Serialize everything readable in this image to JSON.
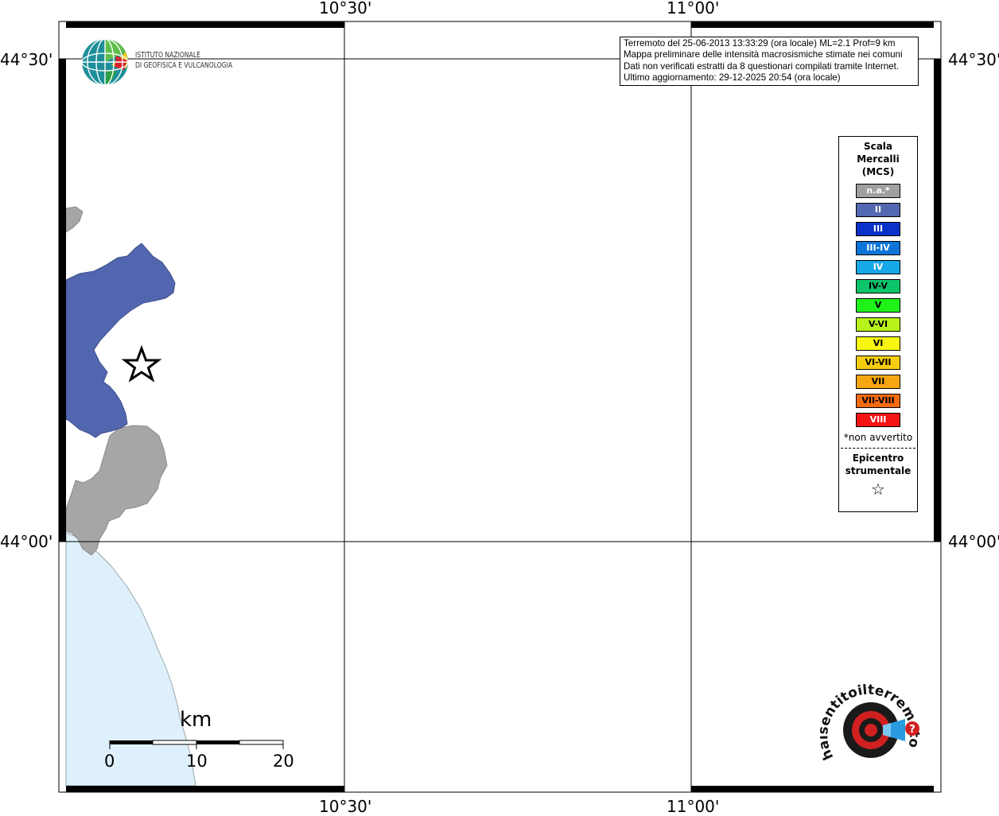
{
  "map": {
    "lon_labels": [
      "10°30'",
      "11°00'"
    ],
    "lat_labels": [
      "44°30'",
      "44°00'"
    ]
  },
  "info": {
    "line1": "Terremoto del 25-06-2013 13:33:29 (ora locale) ML=2.1 Prof=9 km",
    "line2": "Mappa preliminare delle intensità macrosismiche stimate nei comuni",
    "line3": "Dati non verificati estratti da 8 questionari compilati tramite Internet.",
    "line4": "Ultimo aggiornamento: 29-12-2025 20:54 (ora locale)"
  },
  "logo": {
    "line1": "ISTITUTO NAZIONALE",
    "line2": "DI GEOFISICA E VULCANOLOGIA"
  },
  "legend": {
    "title_lines": [
      "Scala",
      "Mercalli",
      "(MCS)"
    ],
    "classes": [
      {
        "label": "n.a.*",
        "color": "#a0a0a0",
        "text": "#ffffff"
      },
      {
        "label": "II",
        "color": "#5268b0",
        "text": "#ffffff"
      },
      {
        "label": "III",
        "color": "#0a31c8",
        "text": "#ffffff"
      },
      {
        "label": "III-IV",
        "color": "#0d74d8",
        "text": "#ffffff"
      },
      {
        "label": "IV",
        "color": "#16a8e8",
        "text": "#ffffff"
      },
      {
        "label": "IV-V",
        "color": "#0cc56a",
        "text": "#000000"
      },
      {
        "label": "V",
        "color": "#1ef219",
        "text": "#000000"
      },
      {
        "label": "V-VI",
        "color": "#b7f31b",
        "text": "#000000"
      },
      {
        "label": "VI",
        "color": "#f7f713",
        "text": "#000000"
      },
      {
        "label": "VI-VII",
        "color": "#f4cd10",
        "text": "#000000"
      },
      {
        "label": "VII",
        "color": "#f6a612",
        "text": "#000000"
      },
      {
        "label": "VII-VIII",
        "color": "#f46a10",
        "text": "#000000"
      },
      {
        "label": "VIII",
        "color": "#f41414",
        "text": "#ffffff"
      }
    ],
    "note": "*non avvertito",
    "epicenter_lines": [
      "Epicentro",
      "strumentale"
    ]
  },
  "scale": {
    "unit": "km",
    "ticks": [
      "0",
      "10",
      "20"
    ]
  },
  "watermark": {
    "text": "haisentitoilterremoto.it  www.",
    "question": "?"
  }
}
